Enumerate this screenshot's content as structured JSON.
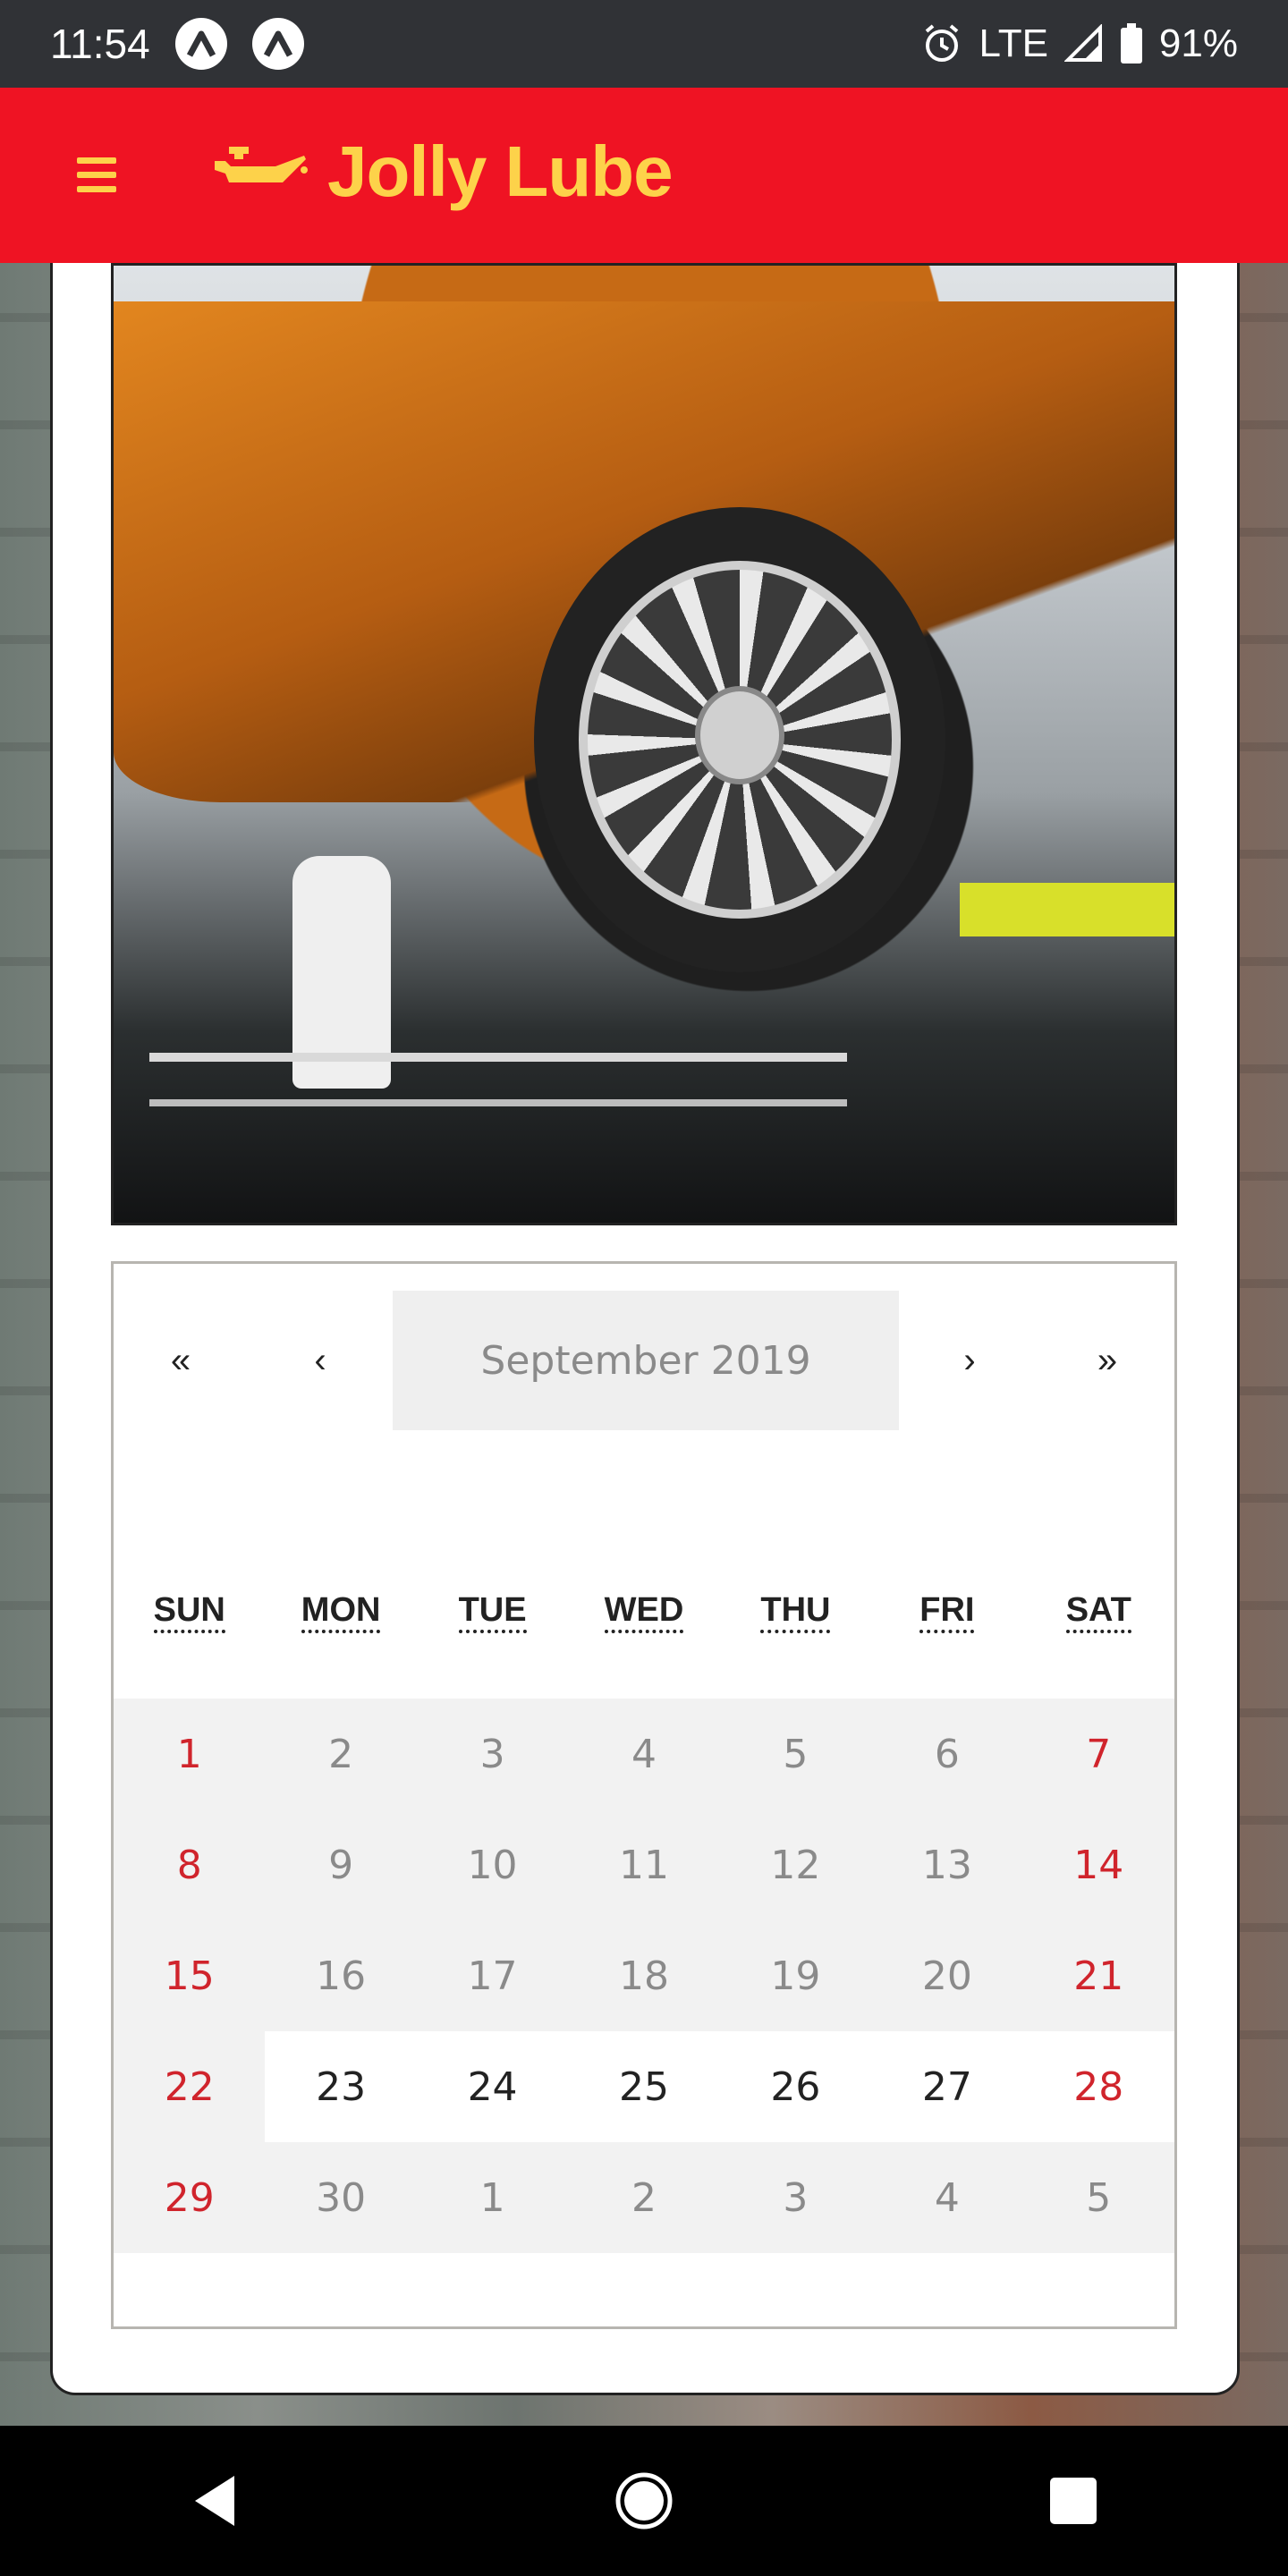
{
  "status_bar": {
    "time": "11:54",
    "network": "LTE",
    "battery": "91%",
    "icons": [
      "app-a-icon",
      "app-a-icon",
      "alarm-icon",
      "signal-icon",
      "battery-icon"
    ]
  },
  "app_bar": {
    "title": "Jolly Lube",
    "brand_icon": "oil-can-icon",
    "menu_icon": "hamburger-icon",
    "colors": {
      "background": "#ef1323",
      "accent": "#fdd24a"
    }
  },
  "calendar": {
    "nav": {
      "prev_year": "«",
      "prev_month": "‹",
      "label": "September 2019",
      "next_month": "›",
      "next_year": "»"
    },
    "weekdays": [
      "SUN",
      "MON",
      "TUE",
      "WED",
      "THU",
      "FRI",
      "SAT"
    ],
    "days": [
      {
        "label": "1",
        "weekend": true,
        "available": false
      },
      {
        "label": "2",
        "weekend": false,
        "available": false
      },
      {
        "label": "3",
        "weekend": false,
        "available": false
      },
      {
        "label": "4",
        "weekend": false,
        "available": false
      },
      {
        "label": "5",
        "weekend": false,
        "available": false
      },
      {
        "label": "6",
        "weekend": false,
        "available": false
      },
      {
        "label": "7",
        "weekend": true,
        "available": false
      },
      {
        "label": "8",
        "weekend": true,
        "available": false
      },
      {
        "label": "9",
        "weekend": false,
        "available": false
      },
      {
        "label": "10",
        "weekend": false,
        "available": false
      },
      {
        "label": "11",
        "weekend": false,
        "available": false
      },
      {
        "label": "12",
        "weekend": false,
        "available": false
      },
      {
        "label": "13",
        "weekend": false,
        "available": false
      },
      {
        "label": "14",
        "weekend": true,
        "available": false
      },
      {
        "label": "15",
        "weekend": true,
        "available": false
      },
      {
        "label": "16",
        "weekend": false,
        "available": false
      },
      {
        "label": "17",
        "weekend": false,
        "available": false
      },
      {
        "label": "18",
        "weekend": false,
        "available": false
      },
      {
        "label": "19",
        "weekend": false,
        "available": false
      },
      {
        "label": "20",
        "weekend": false,
        "available": false
      },
      {
        "label": "21",
        "weekend": true,
        "available": false
      },
      {
        "label": "22",
        "weekend": true,
        "available": false
      },
      {
        "label": "23",
        "weekend": false,
        "available": true
      },
      {
        "label": "24",
        "weekend": false,
        "available": true
      },
      {
        "label": "25",
        "weekend": false,
        "available": true
      },
      {
        "label": "26",
        "weekend": false,
        "available": true
      },
      {
        "label": "27",
        "weekend": false,
        "available": true
      },
      {
        "label": "28",
        "weekend": true,
        "available": true
      },
      {
        "label": "29",
        "weekend": true,
        "available": false
      },
      {
        "label": "30",
        "weekend": false,
        "available": false
      },
      {
        "label": "1",
        "weekend": false,
        "available": false
      },
      {
        "label": "2",
        "weekend": false,
        "available": false
      },
      {
        "label": "3",
        "weekend": false,
        "available": false
      },
      {
        "label": "4",
        "weekend": false,
        "available": false
      },
      {
        "label": "5",
        "weekend": false,
        "available": false
      }
    ]
  },
  "nav_bar": {
    "icons": [
      "back-icon",
      "home-icon",
      "recents-icon"
    ]
  }
}
